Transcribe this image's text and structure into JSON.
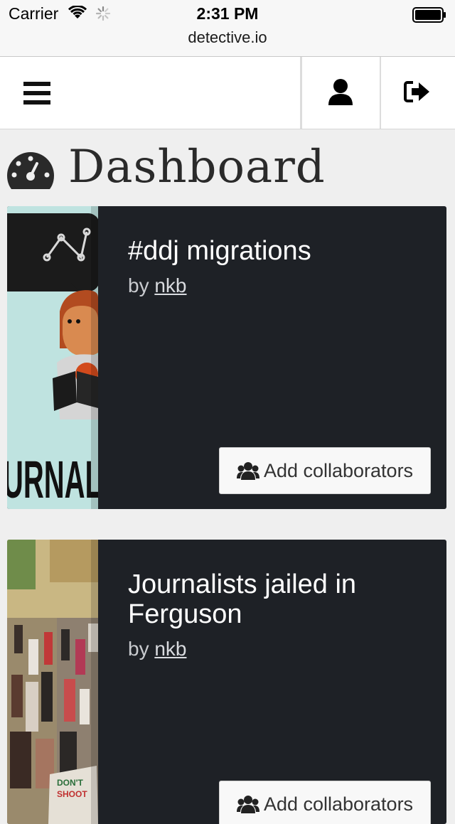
{
  "status_bar": {
    "carrier": "Carrier",
    "time": "2:31 PM",
    "url": "detective.io"
  },
  "navbar": {
    "menu_icon": "hamburger-icon",
    "user_icon": "user-icon",
    "logout_icon": "sign-out-icon"
  },
  "page": {
    "title": "Dashboard",
    "title_icon": "dashboard-gauge-icon"
  },
  "cards": [
    {
      "title": "#ddj migrations",
      "by_prefix": "by",
      "author": "nkb",
      "button_label": "Add collaborators",
      "button_icon": "users-icon"
    },
    {
      "title": "Journalists jailed in Ferguson",
      "by_prefix": "by",
      "author": "nkb",
      "button_label": "Add collaborators",
      "button_icon": "users-icon"
    }
  ],
  "colors": {
    "card_bg": "#1e2126",
    "page_bg": "#efefef"
  }
}
